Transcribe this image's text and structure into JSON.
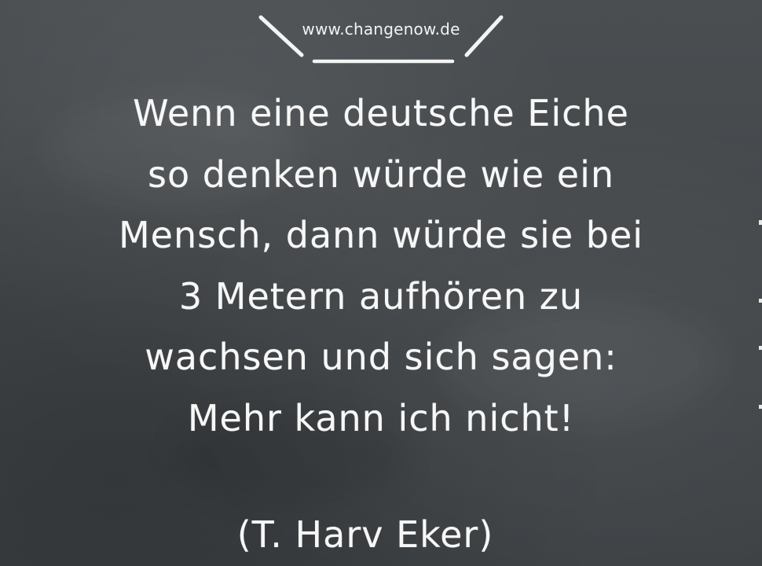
{
  "header": {
    "site_url": "www.changenow.de"
  },
  "quote": {
    "lines": [
      "Wenn eine deutsche Eiche",
      "so denken würde wie ein",
      "Mensch, dann würde sie bei",
      "3 Metern aufhören zu",
      "wachsen und sich sagen:",
      "Mehr kann ich nicht!"
    ],
    "author": "(T. Harv Eker)"
  },
  "colors": {
    "chalkboard": "#45494c",
    "chalk": "#f7f7f7"
  }
}
